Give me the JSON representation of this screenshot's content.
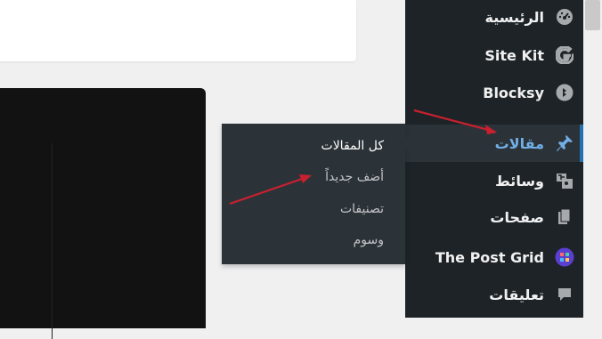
{
  "sidebar": {
    "items": [
      {
        "label": "الرئيسية",
        "icon": "dashboard-gauge-icon"
      },
      {
        "label": "Site Kit",
        "icon": "google-g-icon"
      },
      {
        "label": "Blocksy",
        "icon": "blocksy-logo-icon"
      },
      {
        "label": "مقالات",
        "icon": "pushpin-icon",
        "active": true
      },
      {
        "label": "وسائط",
        "icon": "media-icon"
      },
      {
        "label": "صفحات",
        "icon": "pages-icon"
      },
      {
        "label": "The Post Grid",
        "icon": "post-grid-logo-icon"
      },
      {
        "label": "تعليقات",
        "icon": "comment-bubble-icon"
      }
    ]
  },
  "flyout": {
    "items": [
      {
        "label": "كل المقالات"
      },
      {
        "label": "أضف جديداً"
      },
      {
        "label": "تصنيفات"
      },
      {
        "label": "وسوم"
      }
    ]
  },
  "colors": {
    "sidebar_bg": "#1d2327",
    "flyout_bg": "#2c3338",
    "active_text": "#72aee6",
    "arrow_annotation": "#c9202f"
  }
}
